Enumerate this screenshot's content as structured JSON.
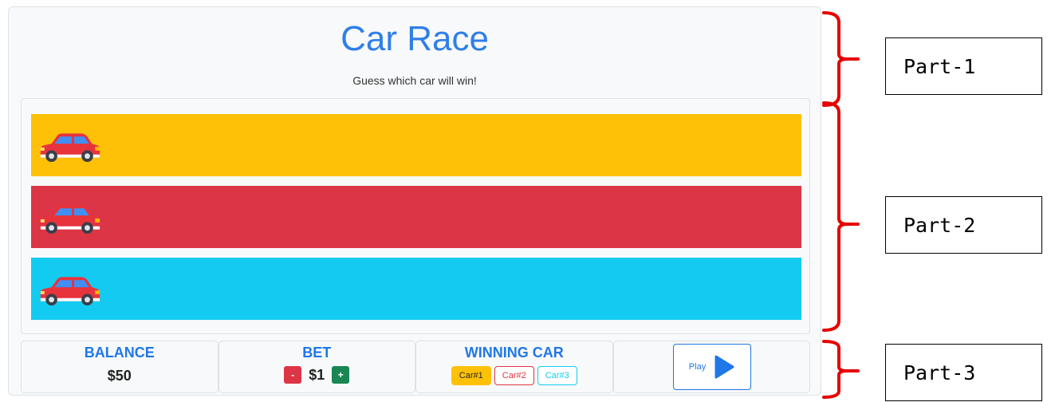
{
  "header": {
    "title": "Car Race",
    "subtitle": "Guess which car will win!"
  },
  "race": {
    "lanes": [
      {
        "name": "lane-1",
        "color": "#ffc107",
        "car_icon": "red-car-icon"
      },
      {
        "name": "lane-2",
        "color": "#dc3545",
        "car_icon": "red-car-icon"
      },
      {
        "name": "lane-3",
        "color": "#13cbf0",
        "car_icon": "red-car-icon"
      }
    ]
  },
  "controls": {
    "balance": {
      "label": "BALANCE",
      "value": "$50"
    },
    "bet": {
      "label": "BET",
      "minus": "-",
      "value": "$1",
      "plus": "+"
    },
    "winning_car": {
      "label": "WINNING CAR",
      "options": [
        "Car#1",
        "Car#2",
        "Car#3"
      ],
      "selected": "Car#1"
    },
    "play": {
      "label": "Play",
      "icon": "play-icon"
    }
  },
  "annotations": {
    "part1": "Part-1",
    "part2": "Part-2",
    "part3": "Part-3"
  },
  "colors": {
    "accent": "#2f7fe8",
    "bracket": "#e60000"
  }
}
